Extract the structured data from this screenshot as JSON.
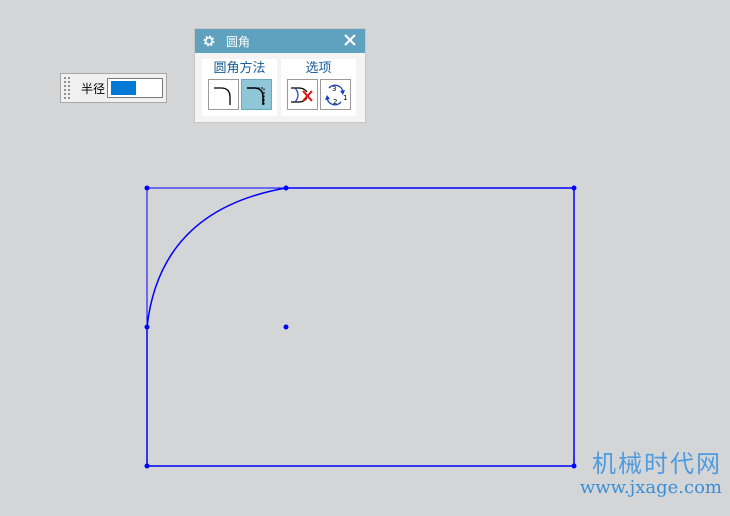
{
  "radius_toolbar": {
    "label": "半径"
  },
  "fillet_dialog": {
    "title": "圆角",
    "groups": [
      {
        "label": "圆角方法"
      },
      {
        "label": "选项"
      }
    ]
  },
  "watermark": {
    "name": "机械时代网",
    "url": "www.jxage.com"
  },
  "colors": {
    "sketch_line": "#0000ff",
    "dialog_title_bar": "#5fa2c0",
    "active_button": "#8fc6d8",
    "selection": "#0078d7",
    "background": "#d4d5d7"
  }
}
